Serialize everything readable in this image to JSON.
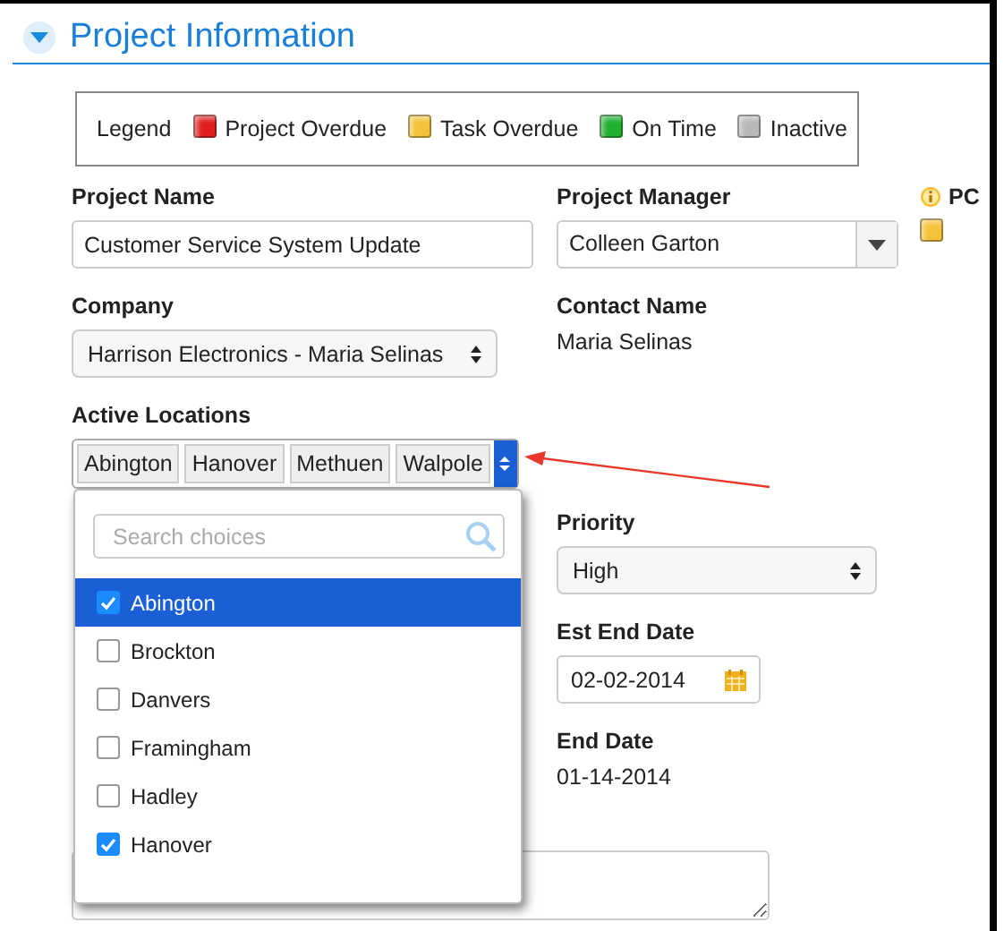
{
  "section": {
    "title": "Project Information",
    "expanded": true
  },
  "legend": {
    "label": "Legend",
    "items": [
      {
        "label": "Project Overdue",
        "color": "#e02020"
      },
      {
        "label": "Task Overdue",
        "color": "#f5c23a"
      },
      {
        "label": "On Time",
        "color": "#20b030"
      },
      {
        "label": "Inactive",
        "color": "#b8b8b8"
      }
    ]
  },
  "project_name": {
    "label": "Project Name",
    "value": "Customer Service System Update"
  },
  "project_manager": {
    "label": "Project Manager",
    "value": "Colleen Garton"
  },
  "pc": {
    "label": "PC",
    "color": "#f5c23a"
  },
  "company": {
    "label": "Company",
    "value": "Harrison Electronics - Maria Selinas"
  },
  "contact_name": {
    "label": "Contact Name",
    "value": "Maria Selinas"
  },
  "active_locations": {
    "label": "Active Locations",
    "tags": [
      "Abington",
      "Hanover",
      "Methuen",
      "Walpole"
    ],
    "expanded": true,
    "search": {
      "placeholder": "Search choices"
    },
    "choices": [
      {
        "label": "Abington",
        "checked": true,
        "selected": true
      },
      {
        "label": "Brockton",
        "checked": false,
        "selected": false
      },
      {
        "label": "Danvers",
        "checked": false,
        "selected": false
      },
      {
        "label": "Framingham",
        "checked": false,
        "selected": false
      },
      {
        "label": "Hadley",
        "checked": false,
        "selected": false
      },
      {
        "label": "Hanover",
        "checked": true,
        "selected": false
      }
    ]
  },
  "priority": {
    "label": "Priority",
    "value": "High"
  },
  "est_end_date": {
    "label": "Est End Date",
    "value": "02-02-2014"
  },
  "end_date": {
    "label": "End Date",
    "value": "01-14-2014"
  }
}
